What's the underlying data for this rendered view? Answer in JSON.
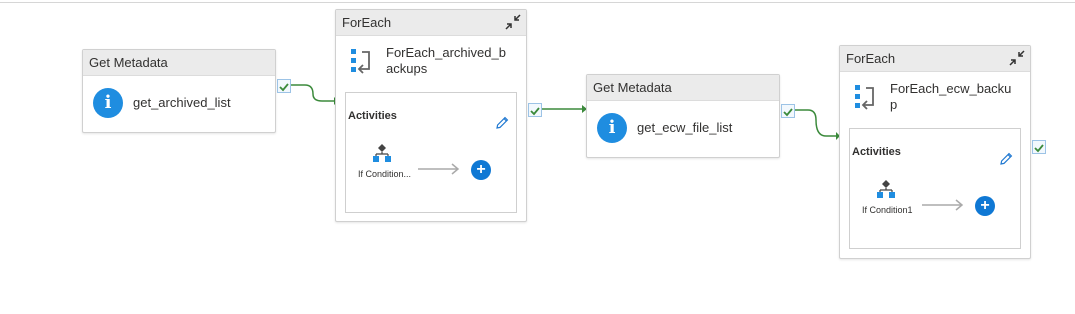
{
  "activities": {
    "get_metadata_1": {
      "header": "Get Metadata",
      "name": "get_archived_list",
      "icon": "info-icon"
    },
    "foreach_1": {
      "header": "ForEach",
      "name": "ForEach_archived_backups",
      "inner_title": "Activities",
      "inner_activity": "If Condition...",
      "icons": [
        "foreach-icon",
        "collapse-icon",
        "edit-pencil-icon",
        "if-condition-icon",
        "add-activity-icon"
      ]
    },
    "get_metadata_2": {
      "header": "Get Metadata",
      "name": "get_ecw_file_list",
      "icon": "info-icon"
    },
    "foreach_2": {
      "header": "ForEach",
      "name": "ForEach_ecw_backup",
      "inner_title": "Activities",
      "inner_activity": "If Condition1",
      "icons": [
        "foreach-icon",
        "collapse-icon",
        "edit-pencil-icon",
        "if-condition-icon",
        "add-activity-icon"
      ]
    }
  },
  "colors": {
    "header_bg": "#ebebeb",
    "success_green": "#3b8a3b",
    "info_blue": "#1f8de0",
    "add_button_blue": "#0f78d4"
  },
  "connectors": [
    "success",
    "success",
    "success"
  ]
}
